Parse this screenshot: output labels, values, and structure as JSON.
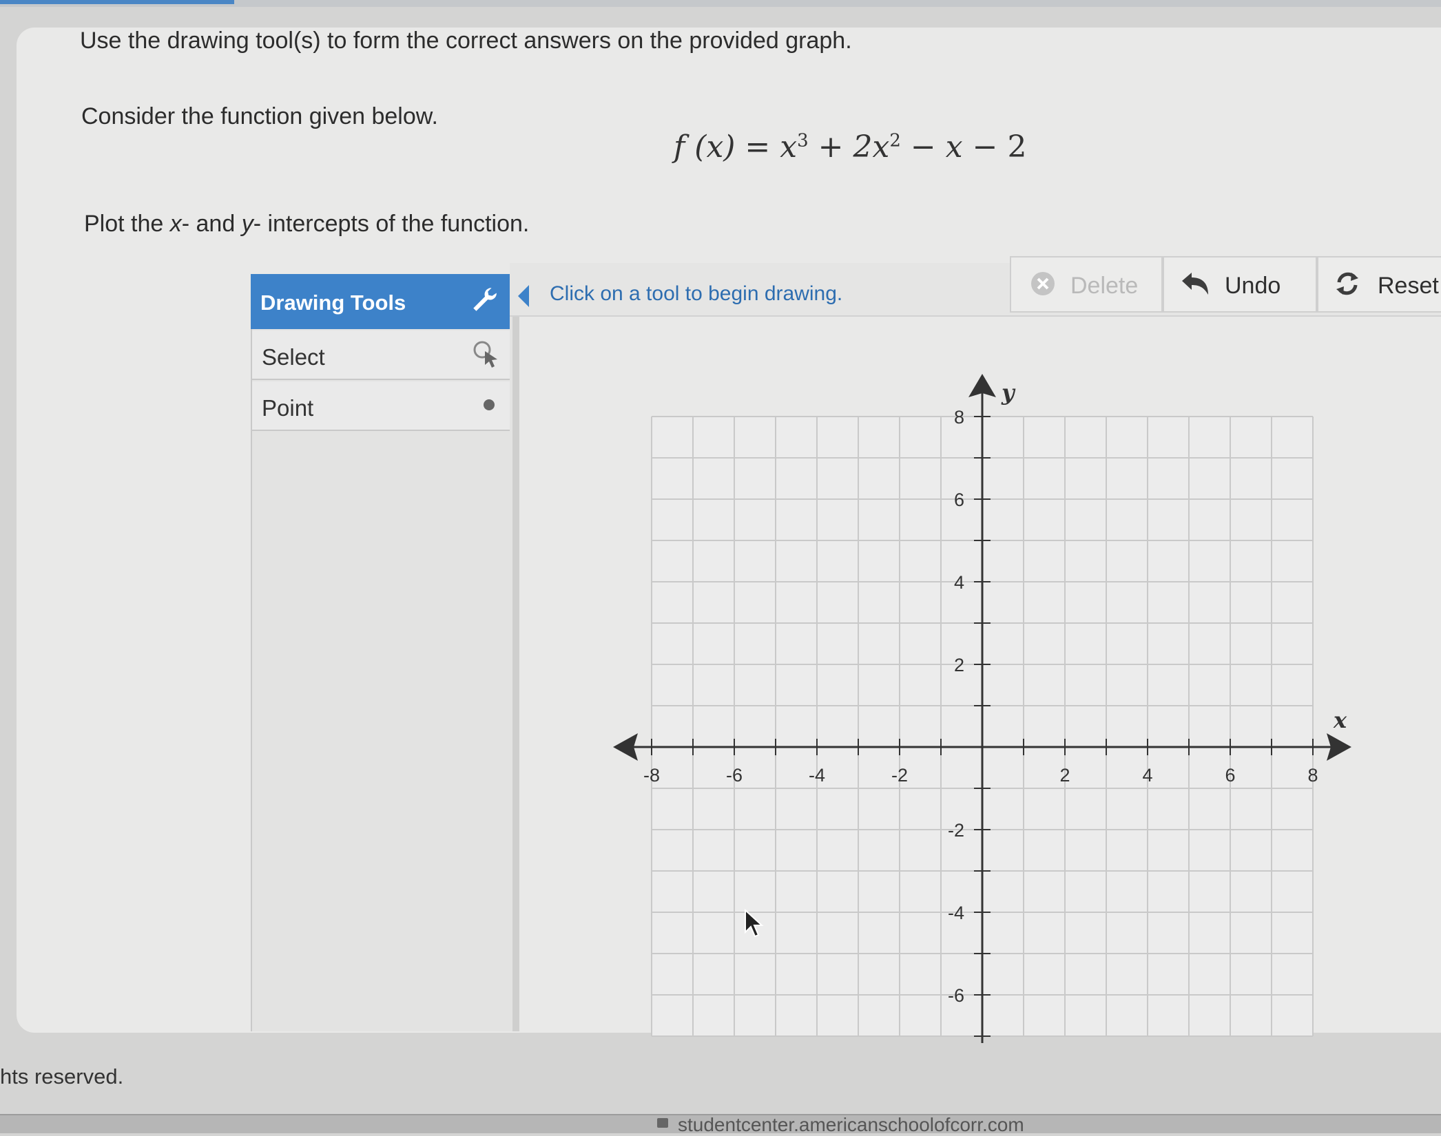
{
  "instructions": {
    "line1": "Use the drawing tool(s) to form the correct answers on the provided graph.",
    "line2": "Consider the function given below.",
    "line3_pre": "Plot the ",
    "line3_x": "x",
    "line3_mid": "- and ",
    "line3_y": "y",
    "line3_post": "- intercepts of the function."
  },
  "formula": {
    "fx": "f (x)",
    "eq": "=",
    "t1": "x",
    "e1": "3",
    "op1": "+",
    "t2": "2x",
    "e2": "2",
    "op2": "−",
    "t3": "x",
    "op3": "−",
    "t4": "2"
  },
  "tools": {
    "header": "Drawing Tools",
    "header_icon": "wrench-icon",
    "items": [
      {
        "label": "Select",
        "icon": "select-pointer-icon"
      },
      {
        "label": "Point",
        "icon": "point-dot-icon"
      }
    ]
  },
  "toolbar": {
    "hint": "Click on a tool to begin drawing.",
    "delete": "Delete",
    "undo": "Undo",
    "reset": "Reset"
  },
  "graph": {
    "x_axis_label": "x",
    "y_axis_label": "y",
    "x_ticks": [
      "-8",
      "-6",
      "-4",
      "-2",
      "2",
      "4",
      "6",
      "8"
    ],
    "y_ticks": [
      "8",
      "6",
      "4",
      "2",
      "-2",
      "-4",
      "-6"
    ],
    "x_range": [
      -8,
      8
    ],
    "y_range": [
      -7,
      8
    ],
    "grid": true
  },
  "footer": {
    "copyright": "hts reserved.",
    "url": "studentcenter.americanschoolofcorr.com"
  },
  "colors": {
    "accent": "#3d82c9",
    "hint_text": "#2d6db0",
    "grid": "#c9c9c9",
    "axis": "#333333"
  }
}
